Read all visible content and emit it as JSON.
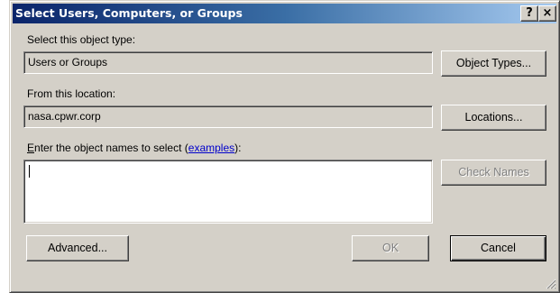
{
  "dialog": {
    "title": "Select Users, Computers, or Groups",
    "help_icon": "question-mark-icon",
    "close_icon": "close-x-icon"
  },
  "object_type": {
    "label": "Select this object type:",
    "value": "Users or Groups",
    "button": "Object Types..."
  },
  "location": {
    "label": "From this location:",
    "value": "nasa.cpwr.corp",
    "button": "Locations..."
  },
  "names": {
    "label_first_char": "E",
    "label_rest": "nter the object names to select (",
    "link": "examples",
    "label_end": "):",
    "value": "",
    "check_button": "Check Names"
  },
  "footer": {
    "advanced_button": "Advanced...",
    "ok_button": "OK",
    "cancel_button": "Cancel"
  },
  "colors": {
    "titlebar_start": "#0a246a",
    "titlebar_end": "#a6caf0",
    "face": "#d4d0c8",
    "link": "#0000cc"
  }
}
